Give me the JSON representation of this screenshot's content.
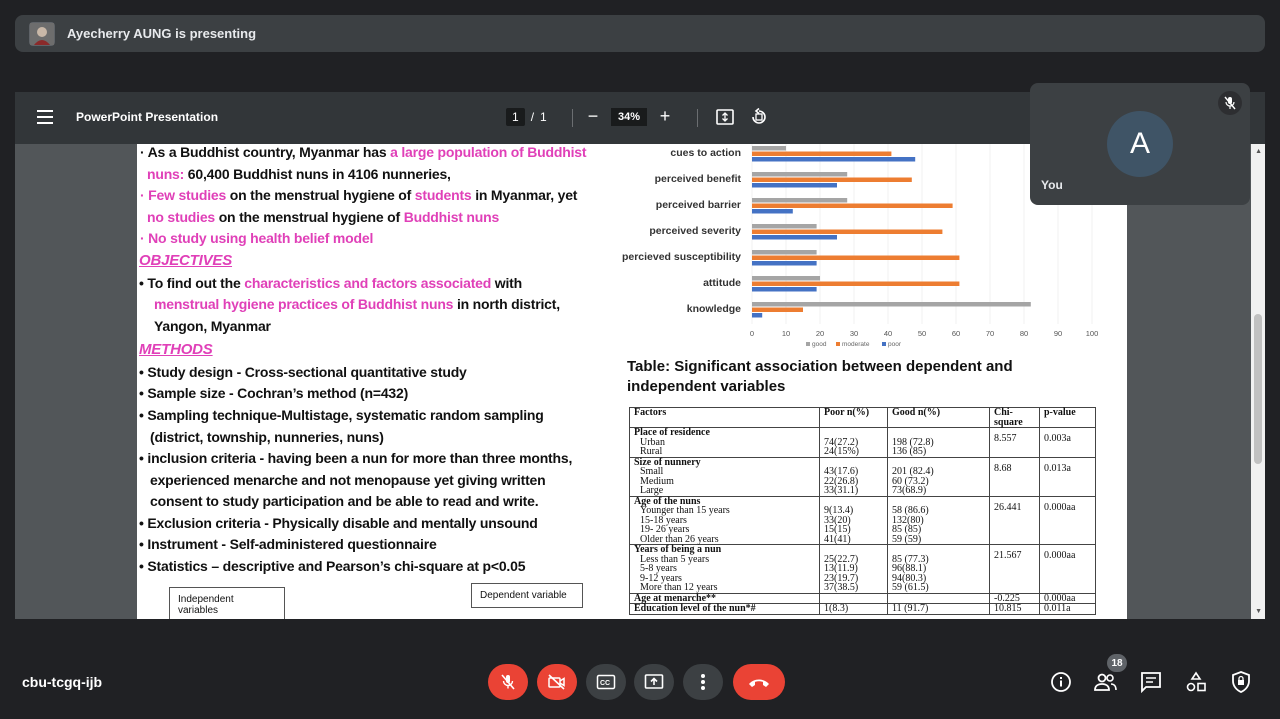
{
  "banner": {
    "presenter_text": "Ayecherry AUNG is presenting"
  },
  "viewer": {
    "title": "PowerPoint Presentation",
    "page_current": "1",
    "page_sep": "/",
    "page_total": "1",
    "zoom": "34%"
  },
  "slide": {
    "b1a": "· As a Buddhist country, Myanmar has ",
    "b1b": "a large population of Buddhist",
    "b1c": "nuns:",
    "b1d": " 60,400 Buddhist nuns in 4106 nunneries,",
    "b2a": "· Few studies",
    "b2b": " on the menstrual hygiene of ",
    "b2c": "students",
    "b2d": " in Myanmar, yet",
    "b2e": "no studies",
    "b2f": " on the menstrual hygiene of ",
    "b2g": "Buddhist nuns",
    "b3": "· No study using health belief model",
    "obj_head": "OBJECTIVES",
    "o1a": "•  To find out the ",
    "o1b": "characteristics and factors associated",
    "o1c": " with",
    "o1d": "menstrual hygiene practices of Buddhist nuns",
    "o1e": " in north district,",
    "o1f": "Yangon, Myanmar",
    "meth_head": "METHODS",
    "m1": "• Study design - Cross-sectional quantitative study",
    "m2": "• Sample size - Cochran’s method (n=432)",
    "m3": "• Sampling technique-Multistage, systematic random sampling",
    "m3b": "(district, township, nunneries, nuns)",
    "m4": "• inclusion criteria - having been a nun for more than three months,",
    "m4b": "experienced menarche and not menopause yet giving written",
    "m4c": "consent to study participation and be able to read and write.",
    "m5": "• Exclusion criteria - Physically disable and mentally unsound",
    "m6": "• Instrument - Self-administered questionnaire",
    "m7": "• Statistics – descriptive and Pearson’s chi-square at p<0.05",
    "box_indep": "Independent variables",
    "box_dep": "Dependent variable",
    "table_caption_1": "Table: Significant association between dependent and",
    "table_caption_2": "independent variables",
    "table": {
      "headers": [
        "Factors",
        "Poor n(%)",
        "Good n(%)",
        "Chi-square",
        "p-value"
      ],
      "groups": [
        {
          "title": "Place of residence",
          "rows": [
            "Urban",
            "Rural"
          ],
          "poor": [
            "74(27.2)",
            "24(15%)"
          ],
          "good": [
            "198 (72.8)",
            "136 (85)"
          ],
          "chi": "8.557",
          "p": "0.003a"
        },
        {
          "title": "Size of nunnery",
          "rows": [
            "Small",
            "Medium",
            "Large"
          ],
          "poor": [
            "43(17.6)",
            "22(26.8)",
            "33(31.1)"
          ],
          "good": [
            "201 (82.4)",
            "60 (73.2)",
            "73(68.9)"
          ],
          "chi": "8.68",
          "p": "0.013a"
        },
        {
          "title": "Age of the nuns",
          "rows": [
            "Younger than 15 years",
            "15-18 years",
            "19- 26 years",
            "Older than 26 years"
          ],
          "poor": [
            "9(13.4)",
            "33(20)",
            "15(15)",
            "41(41)"
          ],
          "good": [
            "58 (86.6)",
            "132(80)",
            "85 (85)",
            "59 (59)"
          ],
          "chi": "26.441",
          "p": "0.000aa"
        },
        {
          "title": "Years of being a nun",
          "rows": [
            "Less than 5 years",
            "5-8 years",
            "9-12 years",
            "More than 12 years"
          ],
          "poor": [
            "25(22.7)",
            "13(11.9)",
            "23(19.7)",
            "37(38.5)"
          ],
          "good": [
            "85 (77.3)",
            "96(88.1)",
            "94(80.3)",
            "59 (61.5)"
          ],
          "chi": "21.567",
          "p": "0.000aa"
        },
        {
          "title": "Age at menarche**",
          "rows": [],
          "poor": [],
          "good": [],
          "chi": "-0.225",
          "p": "0.000aa"
        },
        {
          "title": "Education level of the nun*#",
          "rows": [],
          "poor": [
            "1(8.3)"
          ],
          "good": [
            "11 (91.7)"
          ],
          "chi": "10.815",
          "p": "0.011a"
        }
      ]
    }
  },
  "chart_data": {
    "type": "bar",
    "orientation": "horizontal",
    "categories": [
      "cues to action",
      "perceived benefit",
      "perceived barrier",
      "perceived severity",
      "percieved susceptibility",
      "attitude",
      "knowledge"
    ],
    "series": [
      {
        "name": "good",
        "color": "#a5a5a5",
        "values": [
          10,
          28,
          28,
          19,
          19,
          20,
          82
        ]
      },
      {
        "name": "moderate",
        "color": "#ed7d31",
        "values": [
          41,
          47,
          59,
          56,
          61,
          61,
          15
        ]
      },
      {
        "name": "poor",
        "color": "#4472c4",
        "values": [
          48,
          25,
          12,
          25,
          19,
          19,
          3
        ]
      }
    ],
    "xticks": [
      "0",
      "10",
      "20",
      "30",
      "40",
      "50",
      "60",
      "70",
      "80",
      "90",
      "100"
    ],
    "xlim": [
      0,
      100
    ],
    "legend_placement": "bottom"
  },
  "self_tile": {
    "initial": "A",
    "name": "You"
  },
  "bottom": {
    "meeting_code": "cbu-tcgq-ijb",
    "participant_count": "18"
  }
}
